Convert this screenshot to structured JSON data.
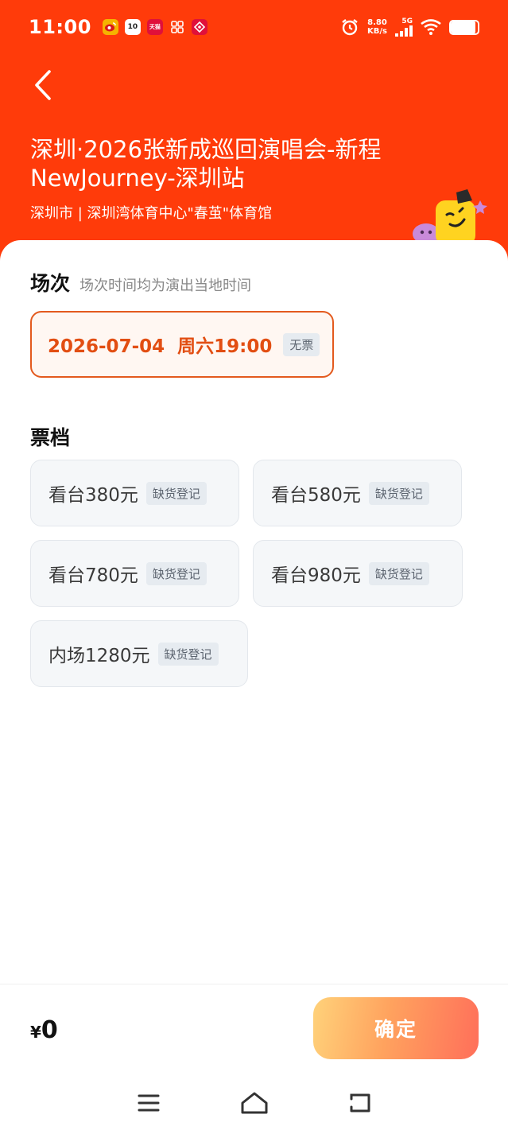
{
  "status_bar": {
    "time": "11:00",
    "net_speed_value": "8.80",
    "net_speed_unit": "KB/s",
    "signal_type": "5G",
    "battery_level": 0.9,
    "notification_icons": [
      {
        "name": "weibo-icon",
        "text": "",
        "color": "#f5b400"
      },
      {
        "name": "calendar-icon",
        "text": "10",
        "color": "#ffffff"
      },
      {
        "name": "tmall-icon",
        "text": "天猫",
        "color": "#e0103a"
      },
      {
        "name": "app-grid-icon",
        "text": "",
        "color": "#ffffff"
      },
      {
        "name": "game-icon",
        "text": "",
        "color": "#e0103a"
      }
    ]
  },
  "header": {
    "title": "深圳·2026张新成巡回演唱会-新程NewJourney-深圳站",
    "venue": "深圳市 | 深圳湾体育中心\"春茧\"体育馆",
    "background_color": "#ff3b0a"
  },
  "session_section": {
    "title": "场次",
    "note": "场次时间均为演出当地时间",
    "options": [
      {
        "label": "2026-07-04  周六19:00",
        "badge": "无票",
        "selected": true
      }
    ]
  },
  "ticket_section": {
    "title": "票档",
    "tiers": [
      {
        "label": "看台380元",
        "badge": "缺货登记"
      },
      {
        "label": "看台580元",
        "badge": "缺货登记"
      },
      {
        "label": "看台780元",
        "badge": "缺货登记"
      },
      {
        "label": "看台980元",
        "badge": "缺货登记"
      },
      {
        "label": "内场1280元",
        "badge": "缺货登记"
      }
    ]
  },
  "footer": {
    "currency": "¥",
    "total": "0",
    "confirm_label": "确定"
  },
  "colors": {
    "accent": "#e24e12",
    "brand_header": "#ff3b0a",
    "tag_bg": "#e6ebf0"
  }
}
